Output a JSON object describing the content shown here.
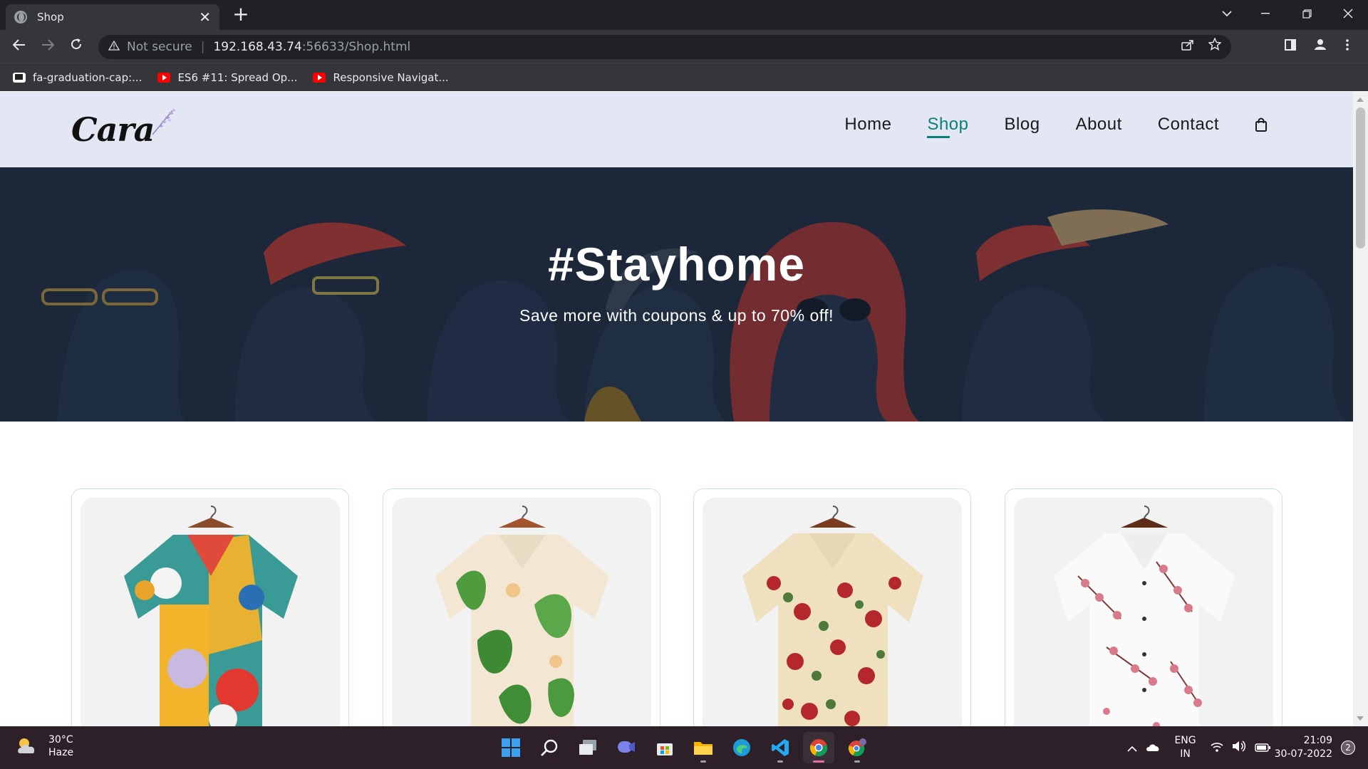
{
  "browser": {
    "tab_title": "Shop",
    "close_glyph": "✕",
    "newtab_glyph": "+",
    "security_label": "Not secure",
    "url_host": "192.168.43.74",
    "url_path": ":56633/Shop.html",
    "bookmarks": [
      {
        "label": "fa-graduation-cap:...",
        "icon": "flag-icon"
      },
      {
        "label": "ES6 #11: Spread Op...",
        "icon": "youtube-icon"
      },
      {
        "label": "Responsive Navigat...",
        "icon": "youtube-icon"
      }
    ]
  },
  "site": {
    "logo_text": "Cara",
    "nav": [
      {
        "label": "Home"
      },
      {
        "label": "Shop",
        "active": true
      },
      {
        "label": "Blog"
      },
      {
        "label": "About"
      },
      {
        "label": "Contact"
      }
    ],
    "accent_color": "#088178",
    "header_bg": "#e3e6f3"
  },
  "hero": {
    "title": "#Stayhome",
    "subtitle": "Save more with coupons & up to 70% off!"
  },
  "products": [
    {
      "name": "colorful-abstract-print-shirt"
    },
    {
      "name": "green-leaf-floral-shirt"
    },
    {
      "name": "rose-floral-beige-shirt"
    },
    {
      "name": "white-cherry-blossom-shirt"
    }
  ],
  "taskbar": {
    "temperature": "30°C",
    "condition": "Haze",
    "lang_top": "ENG",
    "lang_bottom": "IN",
    "time": "21:09",
    "date": "30-07-2022",
    "notifications": "2"
  }
}
